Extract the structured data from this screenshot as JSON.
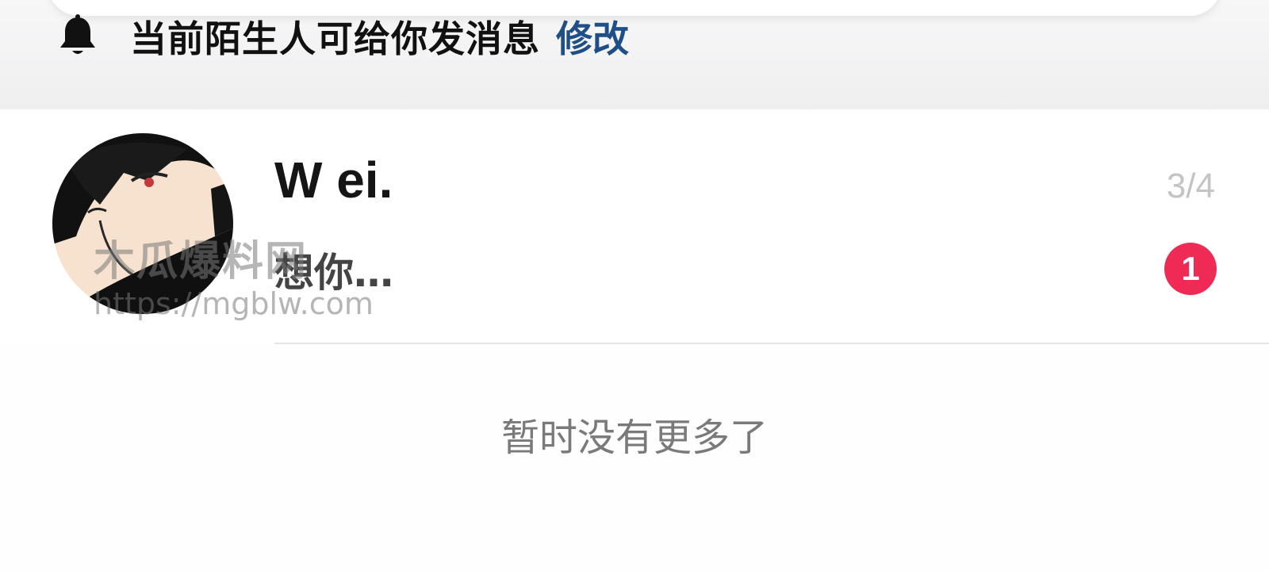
{
  "notice": {
    "text": "当前陌生人可给你发消息",
    "action_label": "修改"
  },
  "chat": {
    "name": "W ei.",
    "date": "3/4",
    "preview": "想你…",
    "unread_count": "1"
  },
  "watermark": {
    "title": "木瓜爆料网",
    "url": "https://mgblw.com"
  },
  "footer": {
    "end_text": "暂时没有更多了"
  },
  "colors": {
    "accent_link": "#1e4f86",
    "badge": "#ee2a55"
  }
}
